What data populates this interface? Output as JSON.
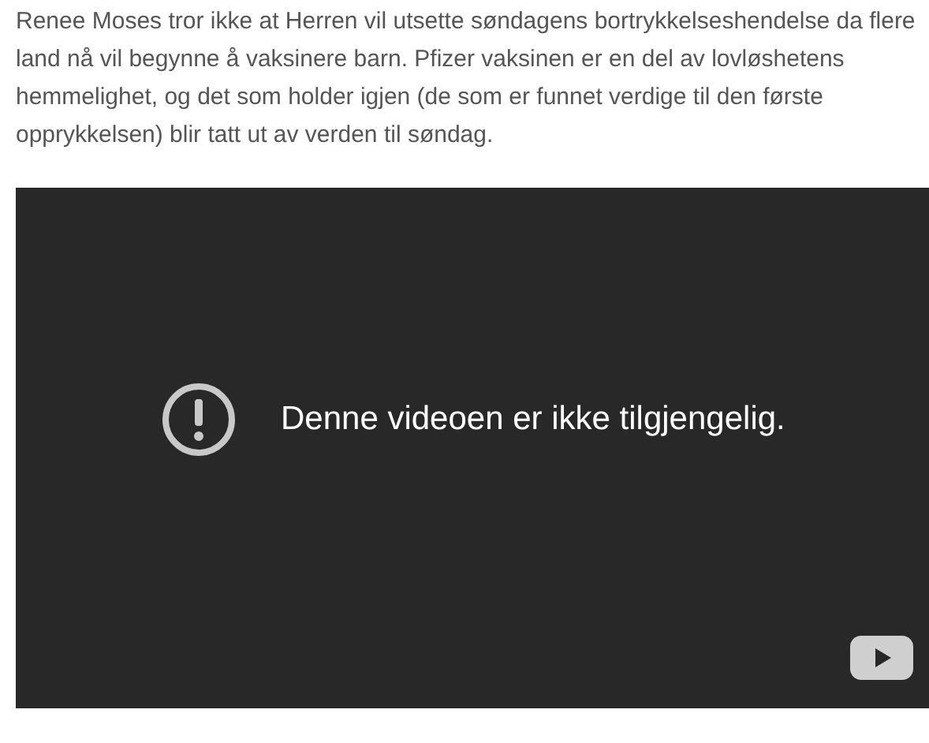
{
  "article": {
    "paragraph": "Renee Moses tror ikke at Herren vil utsette søndagens bortrykkelseshendelse da flere land nå vil begynne å vaksinere barn. Pfizer vaksinen er en del av lovløshetens hemmelighet, og det som holder igjen (de som er funnet verdige til den første opprykkelsen) blir tatt ut av verden til søndag."
  },
  "video": {
    "message": "Denne videoen er ikke tilgjengelig."
  }
}
